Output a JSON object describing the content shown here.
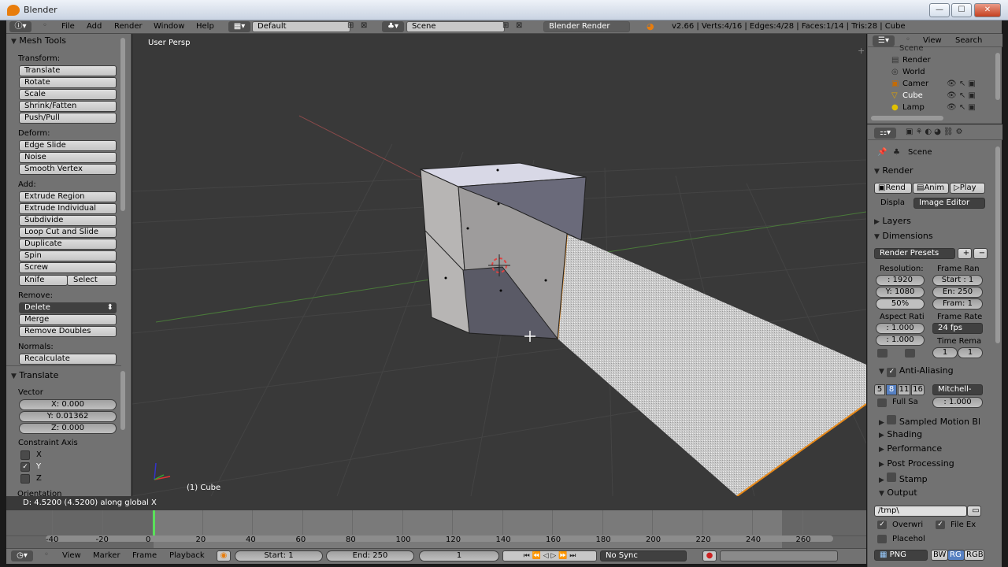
{
  "window": {
    "title": "Blender",
    "min": "—",
    "max": "☐",
    "close": "✕"
  },
  "info": {
    "menus": [
      "File",
      "Add",
      "Render",
      "Window",
      "Help"
    ],
    "layout": "Default",
    "scene": "Scene",
    "engine": "Blender Render",
    "stats": "v2.66 | Verts:4/16 | Edges:4/28 | Faces:1/14 | Tris:28 | Cube"
  },
  "toolshelf": {
    "title": "Mesh Tools",
    "transform_label": "Transform:",
    "transform": [
      "Translate",
      "Rotate",
      "Scale",
      "Shrink/Fatten",
      "Push/Pull"
    ],
    "deform_label": "Deform:",
    "deform": [
      "Edge Slide",
      "Noise",
      "Smooth Vertex"
    ],
    "add_label": "Add:",
    "add": [
      "Extrude Region",
      "Extrude Individual",
      "Subdivide",
      "Loop Cut and Slide",
      "Duplicate",
      "Spin",
      "Screw"
    ],
    "knife": "Knife",
    "select": "Select",
    "remove_label": "Remove:",
    "delete": "Delete",
    "merge": "Merge",
    "remove_doubles": "Remove Doubles",
    "normals_label": "Normals:",
    "recalculate": "Recalculate",
    "op_title": "Translate",
    "vector_label": "Vector",
    "x": "X: 0.000",
    "y": "Y: 0.01362",
    "z": "Z: 0.000",
    "constraint_label": "Constraint Axis",
    "cx": "X",
    "cy": "Y",
    "cz": "Z",
    "orientation": "Orientation"
  },
  "viewport": {
    "label": "User Persp",
    "object": "(1) Cube",
    "status": "D: 4.5200 (4.5200) along global X"
  },
  "timeline": {
    "ticks": [
      "-40",
      "-20",
      "0",
      "20",
      "40",
      "60",
      "80",
      "100",
      "120",
      "140",
      "160",
      "180",
      "200",
      "220",
      "240",
      "260"
    ],
    "menus": [
      "View",
      "Marker",
      "Frame",
      "Playback"
    ],
    "start": "Start: 1",
    "end": "End: 250",
    "current": "1",
    "sync": "No Sync"
  },
  "outliner": {
    "menus": [
      "View",
      "Search"
    ],
    "items": [
      "Scene",
      "Render",
      "World",
      "Camer",
      "Cube",
      "Lamp"
    ]
  },
  "props": {
    "scene": "Scene",
    "render": "Render",
    "rend": "Rend",
    "anim": "Anim",
    "play": "Play",
    "displa": "Displa",
    "image_editor": "Image Editor",
    "layers": "Layers",
    "dimensions": "Dimensions",
    "presets": "Render Presets",
    "resolution": "Resolution:",
    "frame_range": "Frame Ran",
    "res_x": ": 1920",
    "res_y": "Y: 1080",
    "res_pct": "50%",
    "start": "Start : 1",
    "end": "En: 250",
    "step": "Fram: 1",
    "aspect": "Aspect Rati",
    "frame_rate": "Frame Rate",
    "ax": ": 1.000",
    "ay": ": 1.000",
    "fps": "24 fps",
    "time_rema": "Time Rema",
    "tr1": "1",
    "tr2": "1",
    "aa": "Anti-Aliasing",
    "aa_vals": [
      "5",
      "8",
      "11",
      "16"
    ],
    "filter": "Mitchell-",
    "full_sa": "Full Sa",
    "filter_size": ": 1.000",
    "motion_blur": "Sampled Motion Bl",
    "shading": "Shading",
    "performance": "Performance",
    "post": "Post Processing",
    "stamp": "Stamp",
    "output": "Output",
    "path": "/tmp\\",
    "overwrite": "Overwri",
    "file_ex": "File Ex",
    "placeholders": "Placehol",
    "format": "PNG",
    "bw": "BW",
    "rg": "RG",
    "rgb": "RGB"
  }
}
